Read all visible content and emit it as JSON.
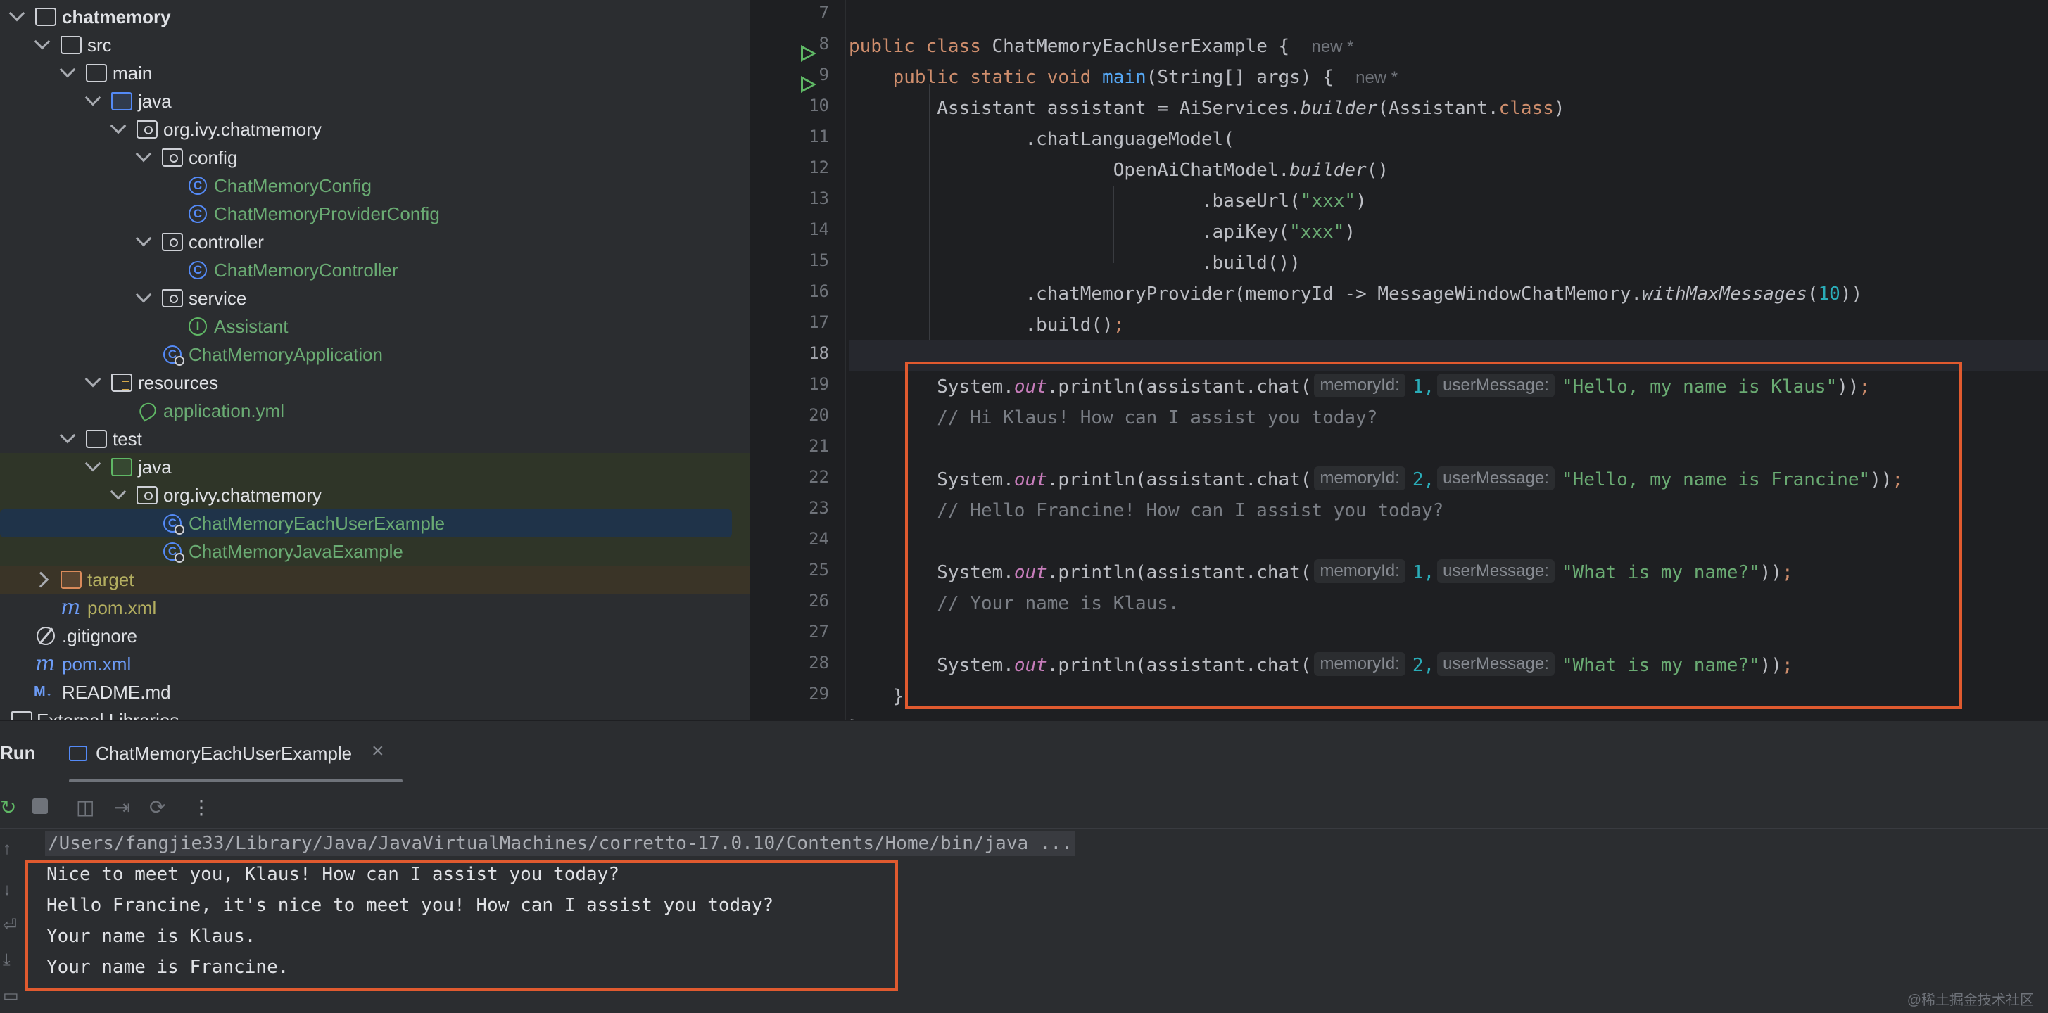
{
  "project_tree": {
    "items": [
      {
        "label": "chatmemory",
        "depth": 0,
        "kind": "project",
        "expanded": true
      },
      {
        "label": "src",
        "depth": 1,
        "kind": "folder",
        "expanded": true
      },
      {
        "label": "main",
        "depth": 2,
        "kind": "folder",
        "expanded": true
      },
      {
        "label": "java",
        "depth": 3,
        "kind": "source-root",
        "expanded": true
      },
      {
        "label": "org.ivy.chatmemory",
        "depth": 4,
        "kind": "package",
        "expanded": true
      },
      {
        "label": "config",
        "depth": 5,
        "kind": "package",
        "expanded": true
      },
      {
        "label": "ChatMemoryConfig",
        "depth": 6,
        "kind": "class"
      },
      {
        "label": "ChatMemoryProviderConfig",
        "depth": 6,
        "kind": "class"
      },
      {
        "label": "controller",
        "depth": 5,
        "kind": "package",
        "expanded": true
      },
      {
        "label": "ChatMemoryController",
        "depth": 6,
        "kind": "class"
      },
      {
        "label": "service",
        "depth": 5,
        "kind": "package",
        "expanded": true
      },
      {
        "label": "Assistant",
        "depth": 6,
        "kind": "interface"
      },
      {
        "label": "ChatMemoryApplication",
        "depth": 5,
        "kind": "app-class"
      },
      {
        "label": "resources",
        "depth": 3,
        "kind": "resources",
        "expanded": true
      },
      {
        "label": "application.yml",
        "depth": 4,
        "kind": "yml"
      },
      {
        "label": "test",
        "depth": 2,
        "kind": "folder",
        "expanded": true
      },
      {
        "label": "java",
        "depth": 3,
        "kind": "test-root",
        "expanded": true
      },
      {
        "label": "org.ivy.chatmemory",
        "depth": 4,
        "kind": "package",
        "expanded": true
      },
      {
        "label": "ChatMemoryEachUserExample",
        "depth": 5,
        "kind": "run-class",
        "selected": true
      },
      {
        "label": "ChatMemoryJavaExample",
        "depth": 5,
        "kind": "run-class"
      },
      {
        "label": "target",
        "depth": 1,
        "kind": "excluded",
        "expanded": false
      },
      {
        "label": "pom.xml",
        "depth": 2,
        "kind": "maven"
      },
      {
        "label": ".gitignore",
        "depth": 1,
        "kind": "ignore"
      },
      {
        "label": "pom.xml",
        "depth": 1,
        "kind": "maven"
      },
      {
        "label": "README.md",
        "depth": 1,
        "kind": "markdown"
      },
      {
        "label": "External Libraries",
        "depth": 0,
        "kind": "libraries",
        "expanded": false
      }
    ]
  },
  "editor": {
    "line_numbers": [
      "7",
      "8",
      "9",
      "10",
      "11",
      "12",
      "13",
      "14",
      "15",
      "16",
      "17",
      "18",
      "19",
      "20",
      "21",
      "22",
      "23",
      "24",
      "25",
      "26",
      "27",
      "28",
      "29"
    ],
    "current_line": "18",
    "run_gutter_lines": [
      "8",
      "9"
    ],
    "new_marker": "new *",
    "hints": {
      "memory_id": "memoryId:",
      "user_message": "userMessage:"
    },
    "code": {
      "l8_public": "public",
      "l8_class": "class",
      "l8_name": "ChatMemoryEachUserExample {",
      "l9_mods": "public static void",
      "l9_main": "main",
      "l9_rest": "(String[] args) {",
      "l10_a": "Assistant assistant = AiServices.",
      "l10_builder": "builder",
      "l10_b": "(Assistant.",
      "l10_class": "class",
      "l10_c": ")",
      "l11": ".chatLanguageModel(",
      "l12_a": "OpenAiChatModel.",
      "l12_builder": "builder",
      "l12_b": "()",
      "l13_a": ".baseUrl(",
      "l13_s": "\"xxx\"",
      "l13_b": ")",
      "l14_a": ".apiKey(",
      "l14_s": "\"xxx\"",
      "l14_b": ")",
      "l15": ".build())",
      "l16_a": ".chatMemoryProvider(memoryId -> MessageWindowChatMemory.",
      "l16_fn": "withMaxMessages",
      "l16_b": "(",
      "l16_n": "10",
      "l16_c": "))",
      "l17_a": ".build()",
      "l17_semi": ";",
      "sys": "System.",
      "out": "out",
      "println": ".println(assistant.chat(",
      "l19_id": "1,",
      "l19_msg": "\"Hello, my name is Klaus\"",
      "l19_end": "))",
      "semi": ";",
      "l20": "// Hi Klaus! How can I assist you today?",
      "l22_id": "2,",
      "l22_msg": "\"Hello, my name is Francine\"",
      "l22_end": "))",
      "l23": "// Hello Francine! How can I assist you today?",
      "l25_id": "1,",
      "l25_msg": "\"What is my name?\"",
      "l25_end": "))",
      "l26": "// Your name is Klaus.",
      "l28_id": "2,",
      "l28_msg": "\"What is my name?\"",
      "l28_end": "))",
      "l29": "}",
      "l30": "}"
    }
  },
  "run_panel": {
    "title": "Run",
    "tab_label": "ChatMemoryEachUserExample",
    "tab_close": "×",
    "command": "/Users/fangjie33/Library/Java/JavaVirtualMachines/corretto-17.0.10/Contents/Home/bin/java ...",
    "output": [
      "Nice to meet you, Klaus! How can I assist you today?",
      "Hello Francine, it's nice to meet you! How can I assist you today?",
      "Your name is Klaus.",
      "Your name is Francine."
    ]
  },
  "watermark": "@稀土掘金技术社区",
  "colors": {
    "highlight_box": "#e05a2f",
    "selection": "#1f3349",
    "string": "#6aab73",
    "keyword": "#cf8e6d"
  }
}
